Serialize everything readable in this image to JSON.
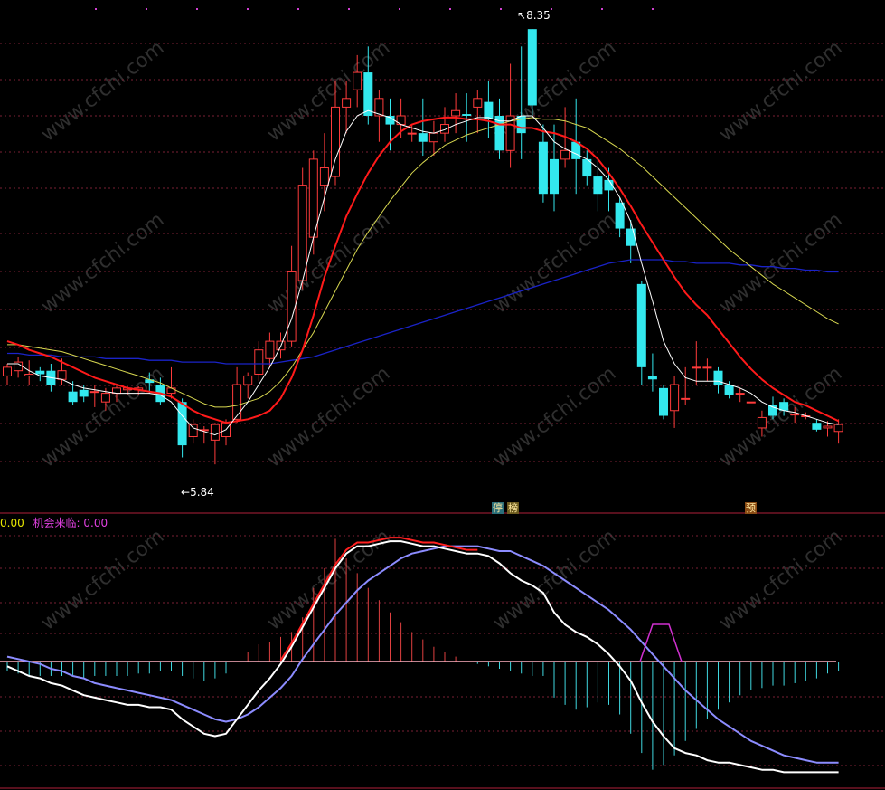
{
  "header": {
    "value_left": "0.00",
    "indicator_label": "机会来临:",
    "indicator_value": "0.00"
  },
  "annotations": {
    "high_label": "8.35",
    "low_label": "5.84",
    "tag_stop": "停",
    "tag_rank": "榜",
    "tag_pre": "预"
  },
  "watermark": "www.cfchi.com",
  "colors": {
    "up": "#ff3b3b",
    "down": "#33e8ee",
    "ma_white": "#ffffff",
    "ma_red": "#ff1a1a",
    "ma_yellow": "#d8d850",
    "ma_blue": "#1a23c8",
    "macd_dif": "#ffffff",
    "macd_dea": "#8c8cff",
    "grid": "#7a1f33"
  },
  "chart_data": {
    "type": "candlestick",
    "y_range": [
      5.7,
      8.45
    ],
    "high": 8.35,
    "low": 5.84,
    "candles": [
      [
        6.35,
        6.4,
        6.3,
        6.42
      ],
      [
        6.38,
        6.43,
        6.34,
        6.46
      ],
      [
        6.35,
        6.36,
        6.3,
        6.44
      ],
      [
        6.38,
        6.36,
        6.32,
        6.4
      ],
      [
        6.38,
        6.3,
        6.26,
        6.42
      ],
      [
        6.33,
        6.38,
        6.3,
        6.45
      ],
      [
        6.26,
        6.2,
        6.18,
        6.32
      ],
      [
        6.27,
        6.23,
        6.2,
        6.3
      ],
      [
        6.26,
        6.26,
        6.17,
        6.3
      ],
      [
        6.2,
        6.25,
        6.15,
        6.28
      ],
      [
        6.25,
        6.28,
        6.2,
        6.3
      ],
      [
        6.27,
        6.28,
        6.24,
        6.29
      ],
      [
        6.27,
        6.28,
        6.24,
        6.29
      ],
      [
        6.33,
        6.31,
        6.25,
        6.37
      ],
      [
        6.3,
        6.2,
        6.18,
        6.34
      ],
      [
        6.25,
        6.28,
        6.22,
        6.4
      ],
      [
        6.2,
        5.95,
        5.88,
        6.22
      ],
      [
        6.0,
        6.07,
        5.96,
        6.1
      ],
      [
        6.04,
        6.04,
        5.96,
        6.06
      ],
      [
        5.98,
        6.07,
        5.84,
        6.08
      ],
      [
        6.0,
        6.08,
        5.95,
        6.1
      ],
      [
        6.1,
        6.3,
        6.08,
        6.4
      ],
      [
        6.3,
        6.35,
        6.22,
        6.37
      ],
      [
        6.36,
        6.5,
        6.32,
        6.55
      ],
      [
        6.45,
        6.55,
        6.4,
        6.6
      ],
      [
        6.5,
        6.55,
        6.45,
        6.6
      ],
      [
        6.55,
        6.95,
        6.52,
        7.1
      ],
      [
        6.9,
        7.45,
        6.85,
        7.55
      ],
      [
        7.15,
        7.6,
        7.05,
        7.65
      ],
      [
        7.45,
        7.55,
        7.3,
        7.75
      ],
      [
        7.5,
        7.9,
        7.45,
        8.05
      ],
      [
        7.9,
        7.95,
        7.75,
        8.05
      ],
      [
        8.0,
        8.1,
        7.9,
        8.2
      ],
      [
        8.1,
        7.85,
        7.8,
        8.25
      ],
      [
        7.85,
        7.95,
        7.7,
        8.0
      ],
      [
        7.85,
        7.8,
        7.65,
        7.95
      ],
      [
        7.8,
        7.85,
        7.72,
        7.95
      ],
      [
        7.75,
        7.75,
        7.7,
        7.8
      ],
      [
        7.75,
        7.7,
        7.62,
        7.95
      ],
      [
        7.7,
        7.75,
        7.62,
        7.82
      ],
      [
        7.75,
        7.8,
        7.7,
        7.9
      ],
      [
        7.85,
        7.88,
        7.75,
        7.98
      ],
      [
        7.86,
        7.85,
        7.7,
        7.98
      ],
      [
        7.9,
        7.95,
        7.75,
        8.0
      ],
      [
        7.93,
        7.83,
        7.72,
        8.05
      ],
      [
        7.85,
        7.65,
        7.6,
        7.95
      ],
      [
        7.65,
        7.85,
        7.55,
        8.15
      ],
      [
        7.85,
        7.75,
        7.6,
        8.25
      ],
      [
        8.35,
        7.91,
        7.85,
        8.35
      ],
      [
        7.7,
        7.4,
        7.35,
        7.8
      ],
      [
        7.6,
        7.4,
        7.3,
        7.8
      ],
      [
        7.6,
        7.65,
        7.55,
        7.9
      ],
      [
        7.7,
        7.6,
        7.4,
        7.95
      ],
      [
        7.6,
        7.5,
        7.45,
        7.65
      ],
      [
        7.5,
        7.4,
        7.3,
        7.6
      ],
      [
        7.48,
        7.42,
        7.3,
        7.55
      ],
      [
        7.35,
        7.2,
        7.15,
        7.38
      ],
      [
        7.2,
        7.1,
        7.0,
        7.25
      ],
      [
        6.88,
        6.4,
        6.3,
        6.9
      ],
      [
        6.35,
        6.33,
        6.26,
        6.48
      ],
      [
        6.28,
        6.12,
        6.1,
        6.3
      ],
      [
        6.15,
        6.3,
        6.05,
        6.35
      ],
      [
        6.22,
        6.22,
        6.18,
        6.4
      ],
      [
        6.4,
        6.4,
        6.3,
        6.55
      ],
      [
        6.4,
        6.4,
        6.32,
        6.45
      ],
      [
        6.38,
        6.3,
        6.25,
        6.4
      ],
      [
        6.3,
        6.24,
        6.22,
        6.32
      ],
      [
        6.25,
        6.25,
        6.2,
        6.28
      ],
      [
        6.2,
        6.2,
        6.2,
        6.2
      ],
      [
        6.05,
        6.11,
        6.0,
        6.15
      ],
      [
        6.18,
        6.12,
        6.1,
        6.23
      ],
      [
        6.2,
        6.15,
        6.12,
        6.22
      ],
      [
        6.13,
        6.13,
        6.08,
        6.17
      ],
      [
        6.12,
        6.12,
        6.1,
        6.14
      ],
      [
        6.08,
        6.04,
        6.03,
        6.1
      ],
      [
        6.05,
        6.06,
        6.0,
        6.09
      ],
      [
        6.03,
        6.07,
        5.96,
        6.1
      ]
    ],
    "ma_white": [
      6.42,
      6.42,
      6.38,
      6.35,
      6.34,
      6.33,
      6.3,
      6.28,
      6.27,
      6.26,
      6.25,
      6.25,
      6.25,
      6.25,
      6.24,
      6.2,
      6.12,
      6.05,
      6.03,
      6.01,
      6.04,
      6.12,
      6.2,
      6.3,
      6.4,
      6.52,
      6.68,
      6.9,
      7.15,
      7.38,
      7.6,
      7.76,
      7.85,
      7.88,
      7.86,
      7.84,
      7.8,
      7.78,
      7.76,
      7.75,
      7.77,
      7.8,
      7.82,
      7.84,
      7.84,
      7.82,
      7.82,
      7.85,
      7.85,
      7.78,
      7.7,
      7.66,
      7.63,
      7.6,
      7.55,
      7.48,
      7.38,
      7.24,
      7.0,
      6.78,
      6.55,
      6.42,
      6.34,
      6.32,
      6.32,
      6.32,
      6.3,
      6.28,
      6.25,
      6.2,
      6.17,
      6.15,
      6.14,
      6.12,
      6.1,
      6.08,
      6.07
    ],
    "ma_red": [
      6.55,
      6.53,
      6.5,
      6.48,
      6.46,
      6.43,
      6.4,
      6.37,
      6.34,
      6.32,
      6.3,
      6.28,
      6.27,
      6.26,
      6.25,
      6.23,
      6.19,
      6.15,
      6.12,
      6.1,
      6.08,
      6.09,
      6.1,
      6.12,
      6.15,
      6.22,
      6.34,
      6.5,
      6.7,
      6.92,
      7.1,
      7.27,
      7.4,
      7.52,
      7.62,
      7.7,
      7.76,
      7.8,
      7.82,
      7.83,
      7.84,
      7.84,
      7.83,
      7.83,
      7.82,
      7.8,
      7.8,
      7.78,
      7.78,
      7.76,
      7.75,
      7.73,
      7.7,
      7.66,
      7.6,
      7.52,
      7.43,
      7.33,
      7.22,
      7.12,
      7.02,
      6.92,
      6.83,
      6.76,
      6.7,
      6.62,
      6.54,
      6.46,
      6.39,
      6.33,
      6.28,
      6.24,
      6.2,
      6.18,
      6.15,
      6.12,
      6.09
    ],
    "ma_yellow": [
      6.53,
      6.53,
      6.52,
      6.51,
      6.5,
      6.49,
      6.47,
      6.45,
      6.43,
      6.41,
      6.39,
      6.37,
      6.35,
      6.33,
      6.31,
      6.28,
      6.25,
      6.22,
      6.19,
      6.17,
      6.17,
      6.18,
      6.2,
      6.22,
      6.26,
      6.32,
      6.4,
      6.5,
      6.6,
      6.72,
      6.84,
      6.96,
      7.08,
      7.18,
      7.27,
      7.36,
      7.44,
      7.52,
      7.58,
      7.63,
      7.68,
      7.71,
      7.74,
      7.76,
      7.78,
      7.8,
      7.82,
      7.83,
      7.84,
      7.83,
      7.83,
      7.82,
      7.8,
      7.78,
      7.74,
      7.7,
      7.66,
      7.61,
      7.56,
      7.5,
      7.44,
      7.38,
      7.32,
      7.26,
      7.2,
      7.14,
      7.08,
      7.03,
      6.98,
      6.93,
      6.88,
      6.84,
      6.8,
      6.76,
      6.72,
      6.68,
      6.65
    ],
    "ma_blue": [
      6.48,
      6.48,
      6.47,
      6.47,
      6.47,
      6.46,
      6.46,
      6.46,
      6.46,
      6.45,
      6.45,
      6.45,
      6.45,
      6.44,
      6.44,
      6.44,
      6.43,
      6.43,
      6.43,
      6.43,
      6.42,
      6.42,
      6.42,
      6.42,
      6.42,
      6.43,
      6.44,
      6.45,
      6.46,
      6.48,
      6.5,
      6.52,
      6.54,
      6.56,
      6.58,
      6.6,
      6.62,
      6.64,
      6.66,
      6.68,
      6.7,
      6.72,
      6.74,
      6.76,
      6.78,
      6.8,
      6.82,
      6.84,
      6.86,
      6.88,
      6.9,
      6.92,
      6.94,
      6.96,
      6.98,
      7.0,
      7.01,
      7.02,
      7.02,
      7.02,
      7.02,
      7.01,
      7.01,
      7.0,
      7.0,
      7.0,
      7.0,
      6.99,
      6.99,
      6.98,
      6.98,
      6.97,
      6.97,
      6.96,
      6.96,
      6.95,
      6.95
    ],
    "macd": {
      "y_range": [
        -0.5,
        0.52
      ],
      "dif": [
        -0.02,
        -0.04,
        -0.06,
        -0.07,
        -0.09,
        -0.1,
        -0.12,
        -0.14,
        -0.15,
        -0.16,
        -0.17,
        -0.18,
        -0.18,
        -0.19,
        -0.19,
        -0.2,
        -0.24,
        -0.27,
        -0.3,
        -0.31,
        -0.3,
        -0.24,
        -0.18,
        -0.12,
        -0.07,
        -0.01,
        0.06,
        0.14,
        0.22,
        0.3,
        0.38,
        0.44,
        0.47,
        0.47,
        0.48,
        0.49,
        0.49,
        0.48,
        0.47,
        0.47,
        0.46,
        0.45,
        0.44,
        0.44,
        0.43,
        0.4,
        0.36,
        0.33,
        0.31,
        0.28,
        0.2,
        0.15,
        0.12,
        0.1,
        0.07,
        0.03,
        -0.02,
        -0.08,
        -0.17,
        -0.25,
        -0.31,
        -0.36,
        -0.38,
        -0.39,
        -0.41,
        -0.42,
        -0.42,
        -0.43,
        -0.44,
        -0.45,
        -0.45,
        -0.46,
        -0.46,
        -0.46,
        -0.46,
        -0.46,
        -0.46
      ],
      "dea": [
        0.02,
        0.01,
        0.0,
        -0.01,
        -0.03,
        -0.04,
        -0.06,
        -0.07,
        -0.09,
        -0.1,
        -0.11,
        -0.12,
        -0.13,
        -0.14,
        -0.15,
        -0.16,
        -0.18,
        -0.2,
        -0.22,
        -0.24,
        -0.25,
        -0.24,
        -0.22,
        -0.19,
        -0.15,
        -0.11,
        -0.06,
        0.01,
        0.07,
        0.13,
        0.19,
        0.24,
        0.29,
        0.33,
        0.36,
        0.39,
        0.42,
        0.44,
        0.45,
        0.46,
        0.47,
        0.47,
        0.47,
        0.47,
        0.46,
        0.45,
        0.45,
        0.43,
        0.41,
        0.39,
        0.36,
        0.33,
        0.3,
        0.27,
        0.24,
        0.21,
        0.17,
        0.13,
        0.08,
        0.03,
        -0.02,
        -0.07,
        -0.12,
        -0.16,
        -0.2,
        -0.24,
        -0.27,
        -0.3,
        -0.33,
        -0.35,
        -0.37,
        -0.39,
        -0.4,
        -0.41,
        -0.42,
        -0.42,
        -0.42
      ],
      "hist": [
        -0.04,
        -0.05,
        -0.06,
        -0.06,
        -0.06,
        -0.06,
        -0.06,
        -0.07,
        -0.06,
        -0.06,
        -0.06,
        -0.06,
        -0.05,
        -0.05,
        -0.04,
        -0.04,
        -0.06,
        -0.07,
        -0.08,
        -0.07,
        -0.05,
        0.0,
        0.04,
        0.07,
        0.08,
        0.1,
        0.12,
        0.18,
        0.3,
        0.38,
        0.5,
        0.42,
        0.36,
        0.3,
        0.25,
        0.2,
        0.16,
        0.12,
        0.09,
        0.06,
        0.04,
        0.02,
        0.0,
        -0.01,
        -0.02,
        -0.03,
        -0.04,
        -0.05,
        -0.06,
        -0.06,
        -0.15,
        -0.18,
        -0.2,
        -0.19,
        -0.17,
        -0.18,
        -0.22,
        -0.3,
        -0.38,
        -0.45,
        -0.43,
        -0.39,
        -0.33,
        -0.28,
        -0.24,
        -0.2,
        -0.17,
        -0.14,
        -0.12,
        -0.11,
        -0.1,
        -0.1,
        -0.09,
        -0.08,
        -0.07,
        -0.05,
        -0.04
      ]
    }
  }
}
